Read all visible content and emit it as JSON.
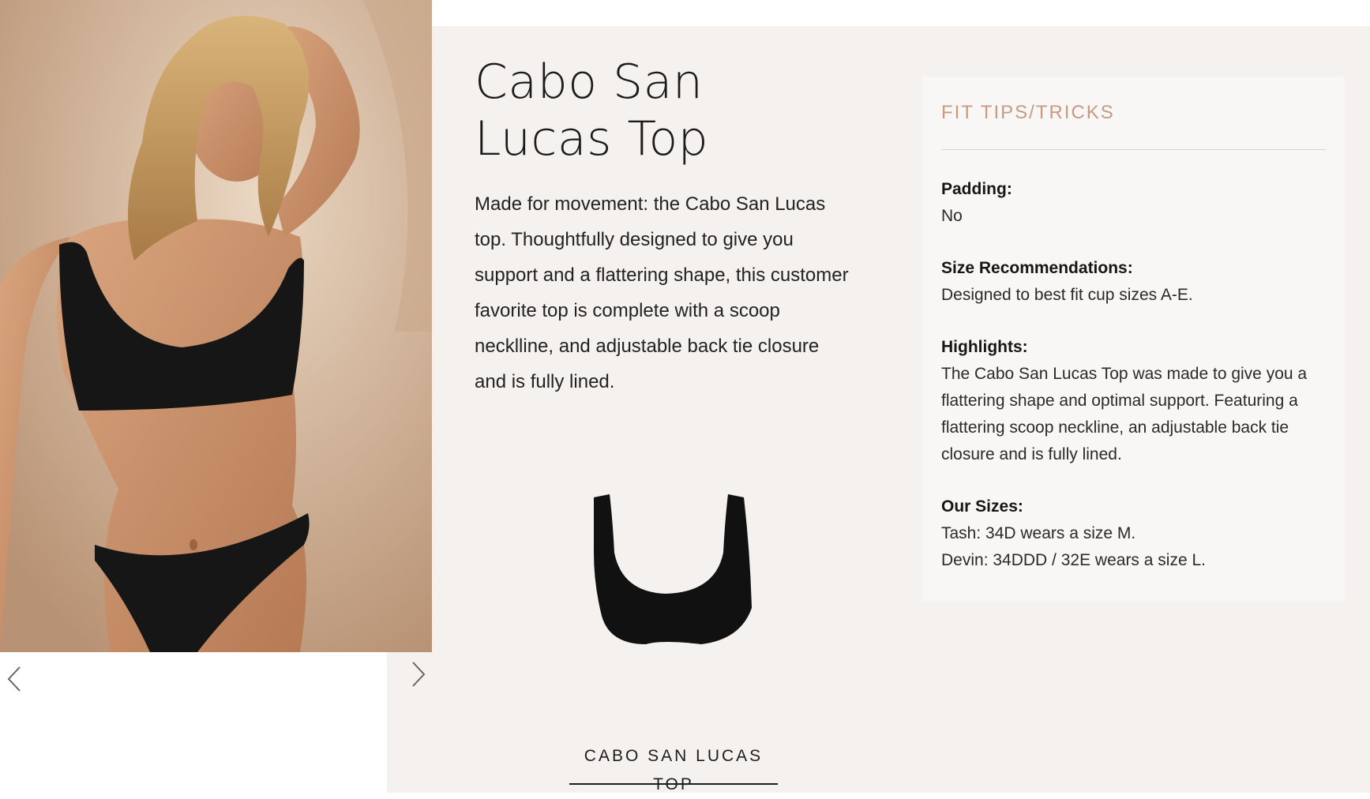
{
  "gallery": {
    "prev_icon": "chevron-left-icon",
    "next_icon": "chevron-right-icon",
    "photo_icon": "model-photo"
  },
  "product": {
    "title": "Cabo San Lucas Top",
    "description": "Made for movement: the Cabo San Lucas top. Thoughtfully designed to give you support and a flattering shape, this customer favorite top is complete with a scoop necklline, and adjustable back tie closure and is fully lined."
  },
  "swatch": {
    "label": "CABO SAN LUCAS TOP",
    "color": "#111111"
  },
  "fit_tips": {
    "heading": "FIT TIPS/TRICKS",
    "sections": [
      {
        "label": "Padding:",
        "lines": [
          "No"
        ]
      },
      {
        "label": "Size Recommendations:",
        "lines": [
          "Designed to best fit cup sizes A-E."
        ]
      },
      {
        "label": "Highlights:",
        "lines": [
          "The Cabo San Lucas Top was made to give you a flattering shape and optimal support. Featuring a flattering scoop neckline, an adjustable back tie closure and is fully lined."
        ]
      },
      {
        "label": "Our Sizes:",
        "lines": [
          "Tash: 34D wears a size M.",
          "Devin: 34DDD / 32E wears a size L."
        ]
      }
    ]
  },
  "colors": {
    "panel_bg": "#f5f1ee",
    "card_bg": "#f8f7f6",
    "accent": "#c79a82"
  }
}
